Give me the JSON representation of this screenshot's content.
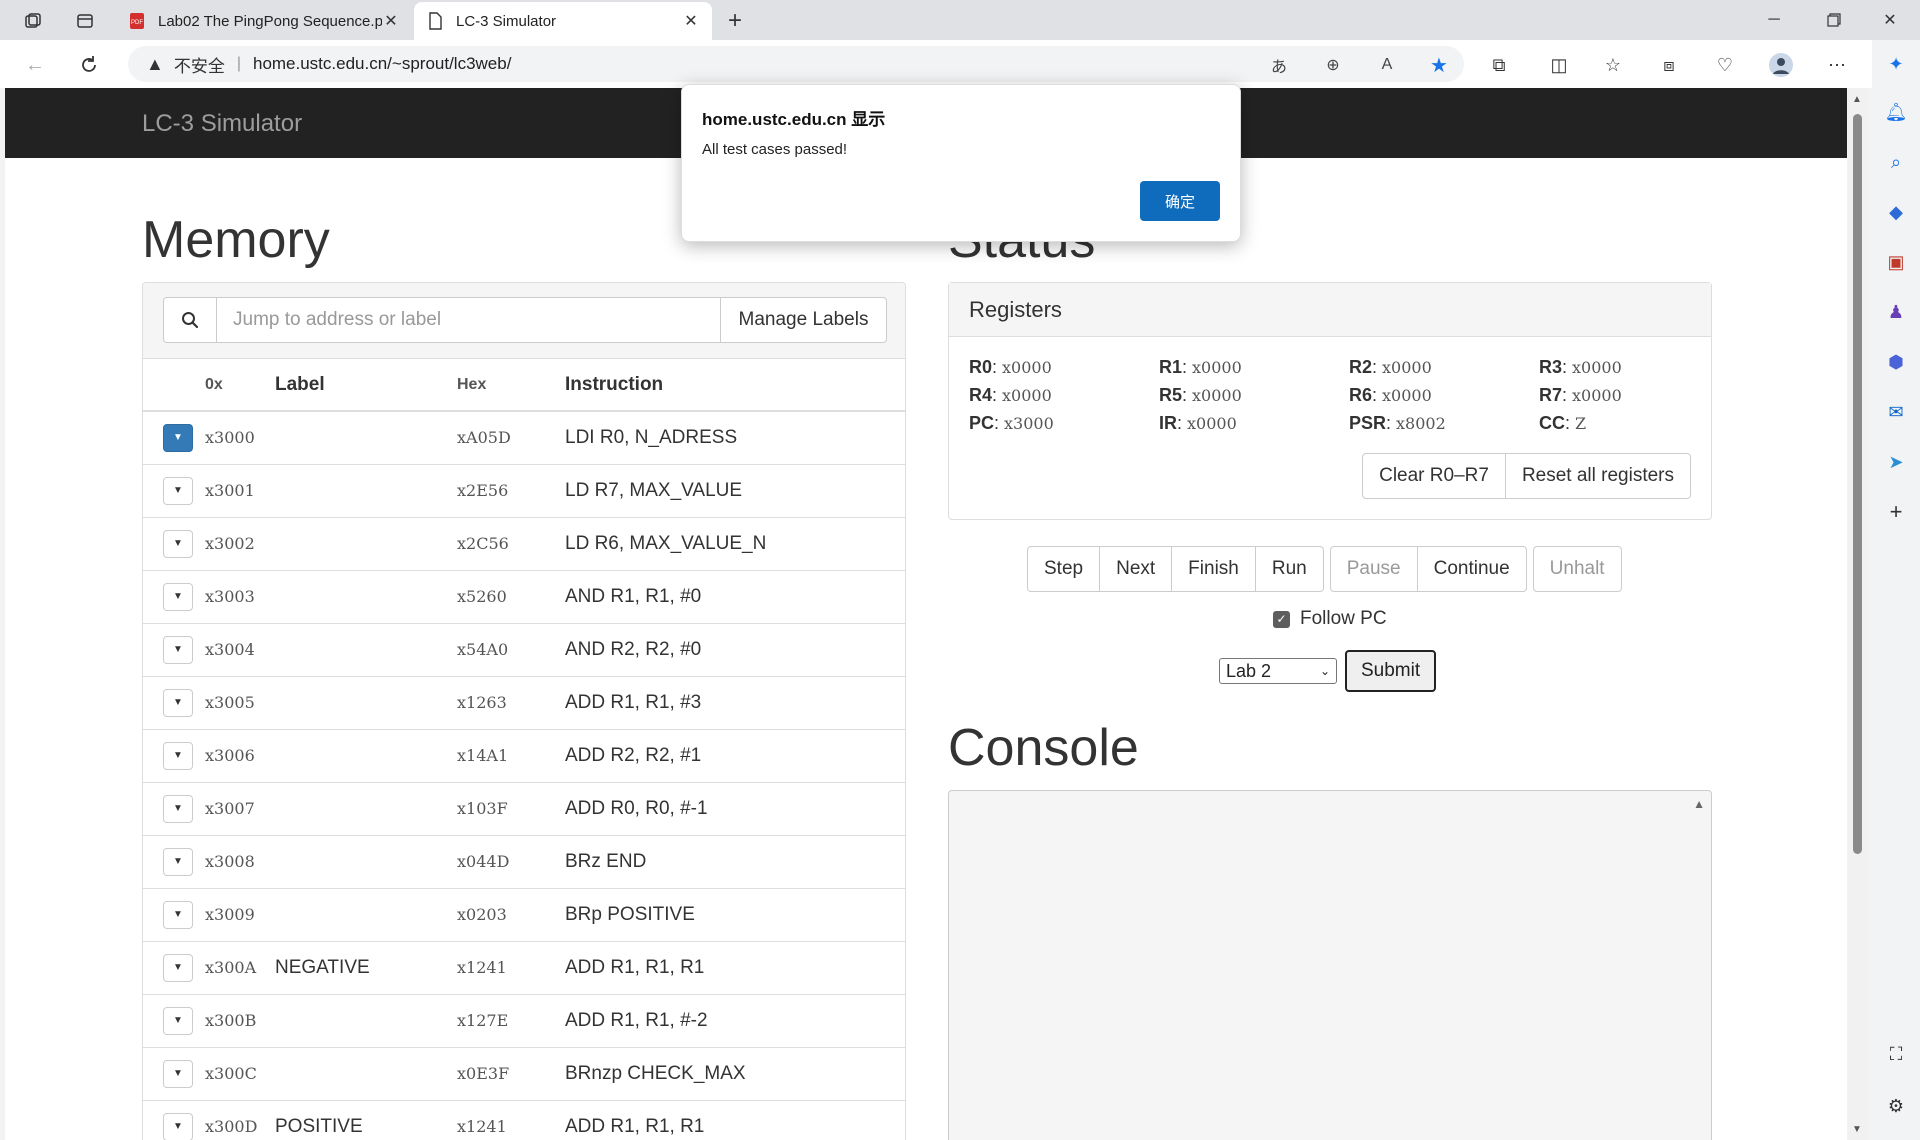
{
  "browser": {
    "tabs": [
      {
        "title": "Lab02 The PingPong Sequence.p",
        "active": false,
        "icon": "pdf-icon"
      },
      {
        "title": "LC-3 Simulator",
        "active": true,
        "icon": "page-icon"
      }
    ],
    "address": {
      "insecure_label": "不安全",
      "url": "home.ustc.edu.cn/~sprout/lc3web/"
    }
  },
  "page": {
    "brand": "LC-3 Simulator",
    "memory": {
      "title": "Memory",
      "search_placeholder": "Jump to address or label",
      "manage_labels": "Manage Labels",
      "columns": [
        "0x",
        "Label",
        "Hex",
        "Instruction"
      ],
      "rows": [
        {
          "addr": "x3000",
          "label": "",
          "hex": "xA05D",
          "instr": "LDI R0, N_ADRESS",
          "pc": true
        },
        {
          "addr": "x3001",
          "label": "",
          "hex": "x2E56",
          "instr": "LD R7, MAX_VALUE",
          "pc": false
        },
        {
          "addr": "x3002",
          "label": "",
          "hex": "x2C56",
          "instr": "LD R6, MAX_VALUE_N",
          "pc": false
        },
        {
          "addr": "x3003",
          "label": "",
          "hex": "x5260",
          "instr": "AND R1, R1, #0",
          "pc": false
        },
        {
          "addr": "x3004",
          "label": "",
          "hex": "x54A0",
          "instr": "AND R2, R2, #0",
          "pc": false
        },
        {
          "addr": "x3005",
          "label": "",
          "hex": "x1263",
          "instr": "ADD R1, R1, #3",
          "pc": false
        },
        {
          "addr": "x3006",
          "label": "",
          "hex": "x14A1",
          "instr": "ADD R2, R2, #1",
          "pc": false
        },
        {
          "addr": "x3007",
          "label": "",
          "hex": "x103F",
          "instr": "ADD R0, R0, #-1",
          "pc": false
        },
        {
          "addr": "x3008",
          "label": "",
          "hex": "x044D",
          "instr": "BRz END",
          "pc": false
        },
        {
          "addr": "x3009",
          "label": "",
          "hex": "x0203",
          "instr": "BRp POSITIVE",
          "pc": false
        },
        {
          "addr": "x300A",
          "label": "NEGATIVE",
          "hex": "x1241",
          "instr": "ADD R1, R1, R1",
          "pc": false
        },
        {
          "addr": "x300B",
          "label": "",
          "hex": "x127E",
          "instr": "ADD R1, R1, #-2",
          "pc": false
        },
        {
          "addr": "x300C",
          "label": "",
          "hex": "x0E3F",
          "instr": "BRnzp CHECK_MAX",
          "pc": false
        },
        {
          "addr": "x300D",
          "label": "POSITIVE",
          "hex": "x1241",
          "instr": "ADD R1, R1, R1",
          "pc": false
        }
      ]
    },
    "status": {
      "title": "Status",
      "registers_title": "Registers",
      "registers": [
        {
          "name": "R0",
          "value": "x0000"
        },
        {
          "name": "R1",
          "value": "x0000"
        },
        {
          "name": "R2",
          "value": "x0000"
        },
        {
          "name": "R3",
          "value": "x0000"
        },
        {
          "name": "R4",
          "value": "x0000"
        },
        {
          "name": "R5",
          "value": "x0000"
        },
        {
          "name": "R6",
          "value": "x0000"
        },
        {
          "name": "R7",
          "value": "x0000"
        },
        {
          "name": "PC",
          "value": "x3000"
        },
        {
          "name": "IR",
          "value": "x0000"
        },
        {
          "name": "PSR",
          "value": "x8002"
        },
        {
          "name": "CC",
          "value": "Z"
        }
      ],
      "clear_label": "Clear R0–R7",
      "reset_label": "Reset all registers",
      "controls": {
        "step": "Step",
        "next": "Next",
        "finish": "Finish",
        "run": "Run",
        "pause": "Pause",
        "continue": "Continue",
        "unhalt": "Unhalt"
      },
      "follow_pc": "Follow PC",
      "follow_pc_checked": true,
      "lab_selected": "Lab 2",
      "submit": "Submit"
    },
    "console": {
      "title": "Console"
    }
  },
  "dialog": {
    "title": "home.ustc.edu.cn 显示",
    "message": "All test cases passed!",
    "ok": "确定"
  },
  "colors": {
    "navbar": "#222222",
    "primary": "#337ab7",
    "dialog_button": "#0f6cbd"
  }
}
